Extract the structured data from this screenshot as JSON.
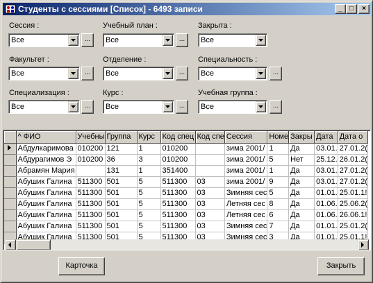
{
  "window": {
    "title": "Студенты с сессиями [Список]  - 6493 записи",
    "min": "_",
    "max": "□",
    "close": "×"
  },
  "filters": {
    "session": {
      "label": "Сессия :",
      "value": "Все",
      "more": "..."
    },
    "plan": {
      "label": "Учебный план :",
      "value": "Все",
      "more": "..."
    },
    "closed": {
      "label": "Закрыта :",
      "value": "Все"
    },
    "faculty": {
      "label": "Факультет :",
      "value": "Все",
      "more": "..."
    },
    "department": {
      "label": "Отделение :",
      "value": "Все",
      "more": "..."
    },
    "specialty": {
      "label": "Специальность :",
      "value": "Все",
      "more": "..."
    },
    "specialization": {
      "label": "Специализация :",
      "value": "Все",
      "more": "..."
    },
    "course": {
      "label": "Курс :",
      "value": "Все",
      "more": "..."
    },
    "group": {
      "label": "Учебная группа :",
      "value": "Все",
      "more": "..."
    }
  },
  "table": {
    "columns": [
      "^ ФИО",
      "Учебны",
      "Группа",
      "Курс",
      "Код спец",
      "Код спе",
      "Сессия",
      "Номе",
      "Закры",
      "Дата",
      "Дата о"
    ],
    "rows": [
      [
        "Абдулкаримова",
        "010200",
        "121",
        "1",
        "010200",
        "",
        "зима 2001/",
        "1",
        "Да",
        "03.01.",
        "27.01.2("
      ],
      [
        "Абдурагимов Э",
        "010200",
        "36",
        "3",
        "010200",
        "",
        "зима 2001/",
        "5",
        "Нет",
        "25.12.",
        "26.01.2("
      ],
      [
        "Абрамян Мария",
        "",
        "131",
        "1",
        "351400",
        "",
        "зима 2001/",
        "1",
        "Да",
        "03.01.",
        "27.01.2("
      ],
      [
        "Абушик Галина",
        "511300",
        "501",
        "5",
        "511300",
        "03",
        "зима 2001/",
        "9",
        "Да",
        "03.01.",
        "27.01.2("
      ],
      [
        "Абушик Галина",
        "511300",
        "501",
        "5",
        "511300",
        "03",
        "Зимняя сес",
        "5",
        "Да",
        "01.01.",
        "25.01.1!"
      ],
      [
        "Абушик Галина",
        "511300",
        "501",
        "5",
        "511300",
        "03",
        "Летняя сес",
        "8",
        "Да",
        "01.06.",
        "25.06.2("
      ],
      [
        "Абушик Галина",
        "511300",
        "501",
        "5",
        "511300",
        "03",
        "Летняя сес",
        "6",
        "Да",
        "01.06.",
        "26.06.1!"
      ],
      [
        "Абушик Галина",
        "511300",
        "501",
        "5",
        "511300",
        "03",
        "Зимняя сес",
        "7",
        "Да",
        "01.01.",
        "25.01.2("
      ],
      [
        "Абушик Галина",
        "511300",
        "501",
        "5",
        "511300",
        "03",
        "Зимняя сес",
        "3",
        "Да",
        "01.01.",
        "25.01.1!"
      ]
    ]
  },
  "buttons": {
    "card": "Карточка",
    "close": "Закрыть"
  }
}
